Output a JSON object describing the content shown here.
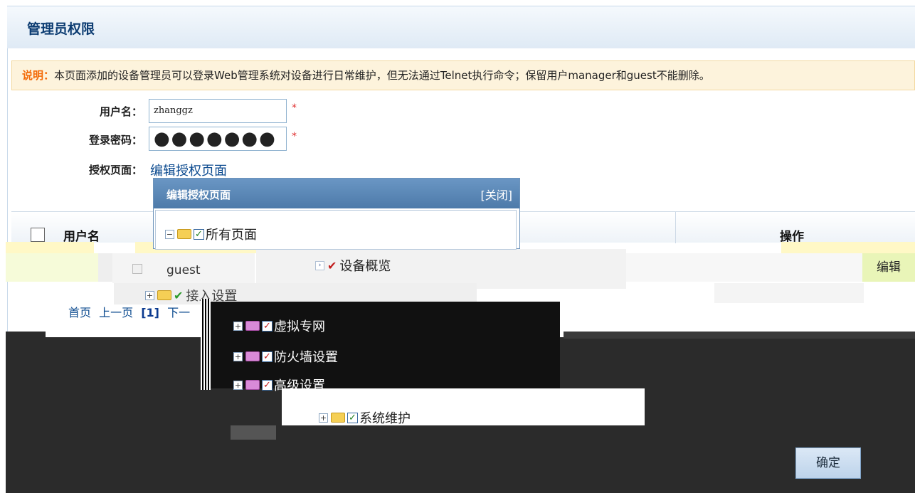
{
  "page": {
    "title": "管理员权限",
    "notice_label": "说明：",
    "notice_text": "本页面添加的设备管理员可以登录Web管理系统对设备进行日常维护，但无法通过Telnet执行命令；保留用户manager和guest不能删除。"
  },
  "form": {
    "username_label": "用户名：",
    "username_value": "zhanggz",
    "password_label": "登录密码：",
    "password_value": "●●●●●●●",
    "auth_label": "授权页面：",
    "auth_link": "编辑授权页面",
    "required_mark": "*"
  },
  "popup": {
    "title": "编辑授权页面",
    "close_label": "[关闭]"
  },
  "tree": {
    "root": "所有页面",
    "items": [
      "设备概览",
      "接入设置",
      "虚拟专网",
      "防火墙设置",
      "高级设置",
      "系统维护"
    ]
  },
  "table": {
    "col_user": "用户名",
    "col_action": "操作",
    "row_user": "guest",
    "row_action": "编辑"
  },
  "pager": {
    "first": "首页",
    "prev": "上一页",
    "current": "[1]",
    "next": "下一"
  },
  "buttons": {
    "ok": "确定"
  }
}
